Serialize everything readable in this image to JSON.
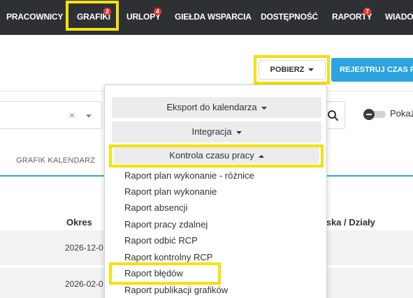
{
  "nav": {
    "items": [
      {
        "label": "PRACOWNICY",
        "badge": ""
      },
      {
        "label": "GRAFIKI",
        "badge": "2"
      },
      {
        "label": "URLOPY",
        "badge": "4"
      },
      {
        "label": "GIEŁDA WSPARCIA",
        "badge": ""
      },
      {
        "label": "DOSTĘPNOŚĆ",
        "badge": ""
      },
      {
        "label": "RAPORTY",
        "badge": "7"
      },
      {
        "label": "WIADO",
        "badge": ""
      }
    ]
  },
  "toolbar": {
    "pobierz_label": "POBIERZ",
    "rejestruj_label": "REJESTRUJ CZAS PR"
  },
  "filters": {
    "clear_symbol": "×",
    "toggle_label": "Pokaż"
  },
  "tabs": {
    "grafik_kalendarz": "GRAFIK KALENDARZ"
  },
  "table": {
    "headers": {
      "okres": "Okres",
      "stanowiska": "wiska / Działy"
    },
    "rows": [
      {
        "date": "2026-12-0"
      },
      {
        "date": "2026-02-0"
      }
    ]
  },
  "dropdown": {
    "sections": [
      {
        "label": "Eksport do kalendarza",
        "expanded": false
      },
      {
        "label": "Integracja",
        "expanded": false
      },
      {
        "label": "Kontrola czasu pracy",
        "expanded": true
      }
    ],
    "items": [
      "Raport plan wykonanie - różnice",
      "Raport plan wykonanie",
      "Raport absencji",
      "Raport pracy zdalnej",
      "Raport odbić RCP",
      "Raport kontrolny RCP",
      "Raport błędów",
      "Raport publikacji grafików"
    ]
  },
  "colors": {
    "nav_bg": "#2e3134",
    "highlight": "#f5e10a",
    "primary": "#2ba4e0",
    "badge": "#e53935"
  }
}
